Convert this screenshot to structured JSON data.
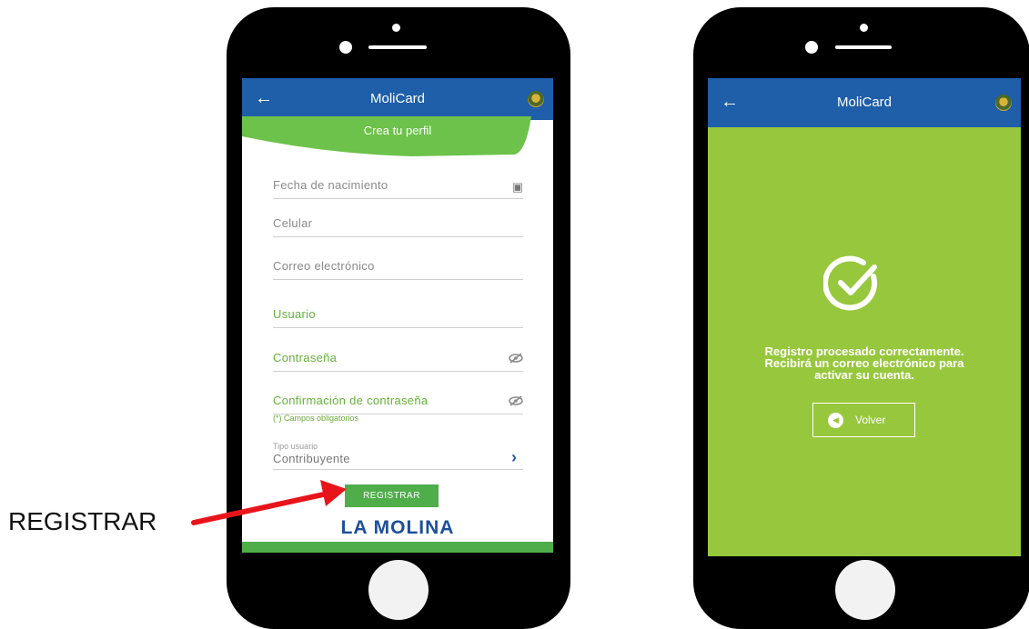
{
  "annotation": {
    "label": "REGISTRAR"
  },
  "phone_left": {
    "appbar": {
      "back_icon": "arrow-left-icon",
      "title": "MoliCard",
      "logo_icon": "municipal-seal-icon"
    },
    "banner": {
      "label": "Crea tu perfil"
    },
    "fields": {
      "birthdate": "Fecha de nacimiento",
      "phone": "Celular",
      "email": "Correo electrónico",
      "username": "Usuario",
      "password": "Contraseña",
      "password_confirm": "Confirmación de contraseña"
    },
    "required_note": "(*) Campos obligatorios",
    "user_type": {
      "label": "Tipo usuario",
      "value": "Contribuyente"
    },
    "register_button": "REGISTRAR",
    "brand": "LA MOLINA"
  },
  "phone_right": {
    "appbar": {
      "back_icon": "arrow-left-icon",
      "title": "MoliCard",
      "logo_icon": "municipal-seal-icon"
    },
    "message": {
      "line1": "Registro procesado correctamente.",
      "line2": "Recibirá un correo electrónico para",
      "line3": "activar su cuenta."
    },
    "back_button": "Volver"
  },
  "colors": {
    "appbar": "#1f5ea8",
    "green_screen": "#97c73d",
    "accent_green": "#65b23a",
    "annotation_arrow": "#e8141b"
  }
}
